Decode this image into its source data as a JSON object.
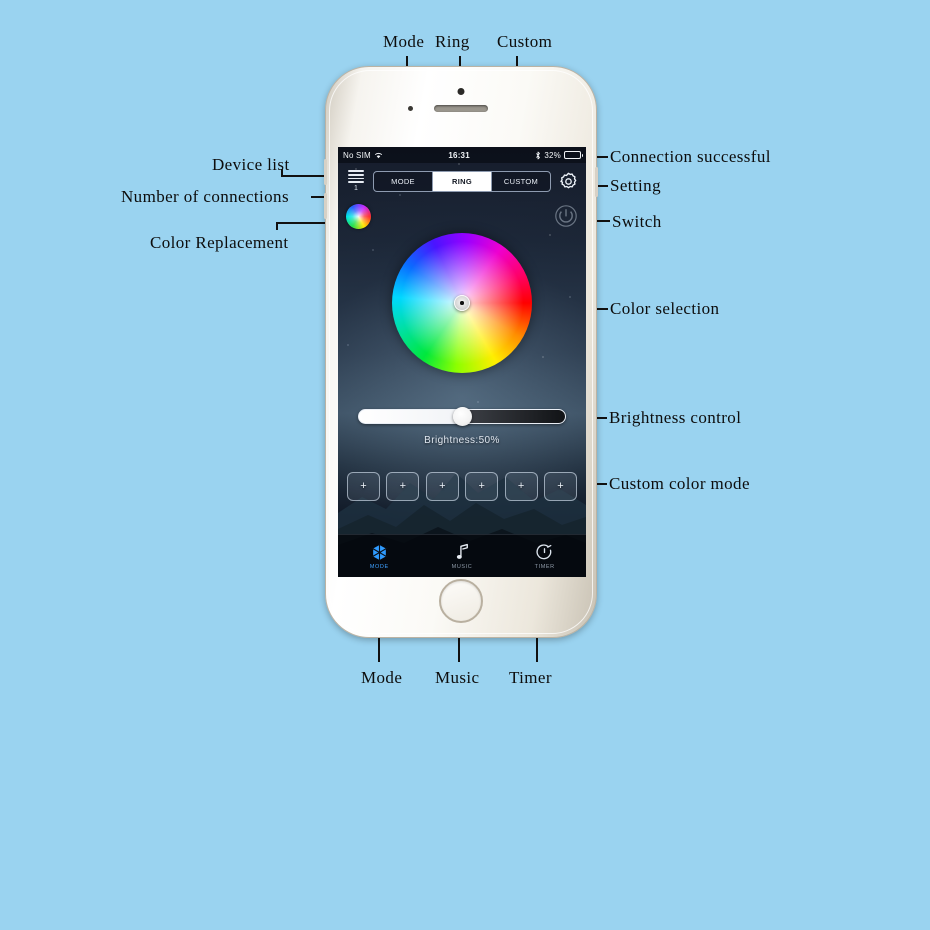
{
  "page": {
    "background_color": "#9ad3f0",
    "title": "LED controller app annotated screenshot"
  },
  "annotations": {
    "top": [
      {
        "id": "mode",
        "label": "Mode"
      },
      {
        "id": "ring",
        "label": "Ring"
      },
      {
        "id": "custom",
        "label": "Custom"
      }
    ],
    "left": [
      {
        "id": "device-list",
        "label": "Device list"
      },
      {
        "id": "number-connections",
        "label": "Number of connections"
      },
      {
        "id": "color-replacement",
        "label": "Color Replacement"
      }
    ],
    "right": [
      {
        "id": "connection-successful",
        "label": "Connection successful"
      },
      {
        "id": "setting",
        "label": "Setting"
      },
      {
        "id": "switch",
        "label": "Switch"
      },
      {
        "id": "color-selection",
        "label": "Color selection"
      },
      {
        "id": "brightness-control",
        "label": "Brightness control"
      },
      {
        "id": "custom-color-mode",
        "label": "Custom color mode"
      }
    ],
    "bottom": [
      {
        "id": "mode",
        "label": "Mode"
      },
      {
        "id": "music",
        "label": "Music"
      },
      {
        "id": "timer",
        "label": "Timer"
      }
    ]
  },
  "phone": {
    "status_bar": {
      "carrier": "No SIM",
      "wifi_icon": "wifi-icon",
      "time": "16:31",
      "bluetooth_icon": "bluetooth-icon",
      "battery_percent": "32%",
      "battery_level": 32
    },
    "topbar": {
      "menu_icon": "hamburger-menu-icon",
      "connection_count": "1",
      "segments": [
        {
          "id": "mode",
          "label": "MODE",
          "active": false
        },
        {
          "id": "ring",
          "label": "RING",
          "active": true
        },
        {
          "id": "custom",
          "label": "CUSTOM",
          "active": false
        }
      ],
      "gear_icon": "gear-icon"
    },
    "row2": {
      "color_swatch_name": "color-replacement-swatch",
      "power_icon": "power-switch-icon"
    },
    "color_wheel": {
      "name": "color-wheel",
      "selector_position": "center"
    },
    "brightness": {
      "label": "Brightness:50%",
      "value": 50
    },
    "presets": [
      {
        "id": "preset-1",
        "label": "+"
      },
      {
        "id": "preset-2",
        "label": "+"
      },
      {
        "id": "preset-3",
        "label": "+"
      },
      {
        "id": "preset-4",
        "label": "+"
      },
      {
        "id": "preset-5",
        "label": "+"
      },
      {
        "id": "preset-6",
        "label": "+"
      }
    ],
    "tabs": [
      {
        "id": "mode",
        "label": "MODE",
        "icon": "snowflake-icon",
        "active": true
      },
      {
        "id": "music",
        "label": "MUSIC",
        "icon": "music-note-icon",
        "active": false
      },
      {
        "id": "timer",
        "label": "TIMER",
        "icon": "timer-clock-icon",
        "active": false
      }
    ]
  }
}
